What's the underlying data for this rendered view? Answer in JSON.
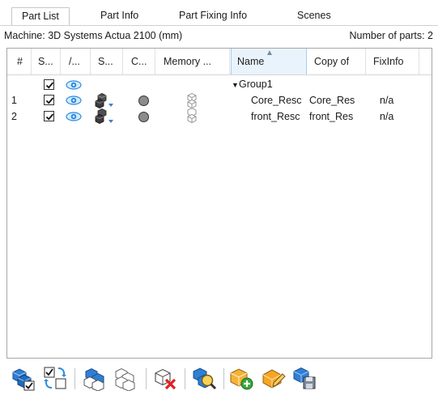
{
  "tabs": [
    {
      "label": "Part List",
      "active": true
    },
    {
      "label": "Part Info",
      "active": false
    },
    {
      "label": "Part Fixing Info",
      "active": false
    },
    {
      "label": "Scenes",
      "active": false
    }
  ],
  "info": {
    "machine": "Machine: 3D Systems Actua 2100 (mm)",
    "parts_count": "Number of parts: 2"
  },
  "table": {
    "columns": [
      "#",
      "S...",
      "/...",
      "S...",
      "C...",
      "Memory ...",
      "Name",
      "Copy of",
      "FixInfo"
    ],
    "sorted_column": "Name",
    "group": {
      "label": "Group1"
    },
    "rows": [
      {
        "num": "1",
        "name": "Core_Resc",
        "copy_of": "Core_Res",
        "fixinfo": "n/a"
      },
      {
        "num": "2",
        "name": "front_Resc",
        "copy_of": "front_Res",
        "fixinfo": "n/a"
      }
    ]
  },
  "toolbar": {
    "buttons": [
      "add-part-icon",
      "swap-icon",
      "duplicate-part-icon",
      "clone-part-icon",
      "remove-part-icon",
      "search-part-icon",
      "add-to-group-icon",
      "edit-group-icon",
      "save-scene-icon"
    ]
  },
  "colors": {
    "eye_blue": "#2a8be0",
    "cube_blue": "#3b7fd0",
    "sort_highlight": "#e9f3fc",
    "group_orange": "#f2a220"
  }
}
